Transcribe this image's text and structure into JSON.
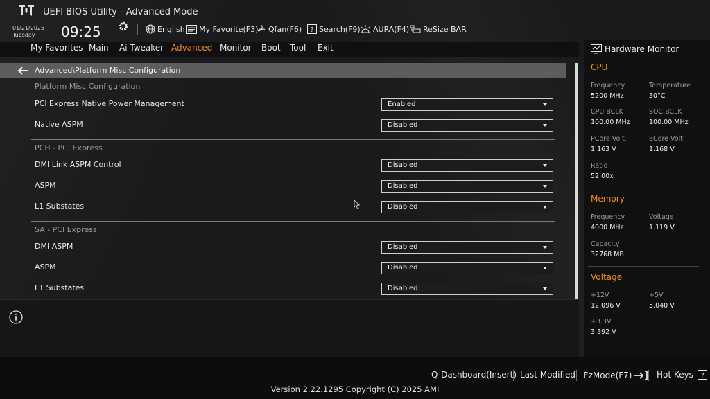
{
  "header": {
    "title": "UEFI BIOS Utility - Advanced Mode",
    "date": "01/21/2025",
    "weekday": "Tuesday",
    "time": "09:25",
    "toolbar": {
      "language": "English",
      "favorite": "My Favorite(F3)",
      "qfan": "Qfan(F6)",
      "search": "Search(F9)",
      "aura": "AURA(F4)",
      "resize_bar": "ReSize BAR"
    }
  },
  "menu": {
    "items": [
      "My Favorites",
      "Main",
      "Ai Tweaker",
      "Advanced",
      "Monitor",
      "Boot",
      "Tool",
      "Exit"
    ],
    "active": "Advanced"
  },
  "main": {
    "breadcrumb": "Advanced\\Platform Misc Configuration",
    "section1": {
      "title": "Platform Misc Configuration",
      "settings": [
        {
          "label": "PCI Express Native Power Management",
          "value": "Enabled"
        },
        {
          "label": "Native ASPM",
          "value": "Disabled"
        }
      ]
    },
    "section2": {
      "title": "PCH - PCI Express",
      "settings": [
        {
          "label": "DMI Link ASPM Control",
          "value": "Disabled"
        },
        {
          "label": "ASPM",
          "value": "Disabled"
        },
        {
          "label": "L1 Substates",
          "value": "Disabled"
        }
      ]
    },
    "section3": {
      "title": "SA - PCI Express",
      "settings": [
        {
          "label": "DMI ASPM",
          "value": "Disabled"
        },
        {
          "label": "ASPM",
          "value": "Disabled"
        },
        {
          "label": "L1 Substates",
          "value": "Disabled"
        }
      ]
    }
  },
  "hw": {
    "title": "Hardware Monitor",
    "cpu": {
      "title": "CPU",
      "frequency_label": "Frequency",
      "frequency": "5200 MHz",
      "temperature_label": "Temperature",
      "temperature": "30°C",
      "bclk_label": "CPU BCLK",
      "bclk": "100.00 MHz",
      "soc_bclk_label": "SOC BCLK",
      "soc_bclk": "100.00 MHz",
      "pcore_label": "PCore Volt.",
      "pcore": "1.163 V",
      "ecore_label": "ECore Volt.",
      "ecore": "1.168 V",
      "ratio_label": "Ratio",
      "ratio": "52.00x"
    },
    "memory": {
      "title": "Memory",
      "frequency_label": "Frequency",
      "frequency": "4000 MHz",
      "voltage_label": "Voltage",
      "voltage": "1.119 V",
      "capacity_label": "Capacity",
      "capacity": "32768 MB"
    },
    "voltage": {
      "title": "Voltage",
      "v12_label": "+12V",
      "v12": "12.096 V",
      "v5_label": "+5V",
      "v5": "5.040 V",
      "v33_label": "+3.3V",
      "v33": "3.392 V"
    }
  },
  "footer": {
    "qdashboard": "Q-Dashboard(Insert)",
    "last_modified": "Last Modified",
    "ezmode": "EzMode(F7)",
    "hotkeys": "Hot Keys",
    "version": "Version 2.22.1295 Copyright (C) 2025 AMI"
  },
  "colors": {
    "accent": "#f08a24",
    "background": "#1a1a1c",
    "panel": "#101011"
  }
}
